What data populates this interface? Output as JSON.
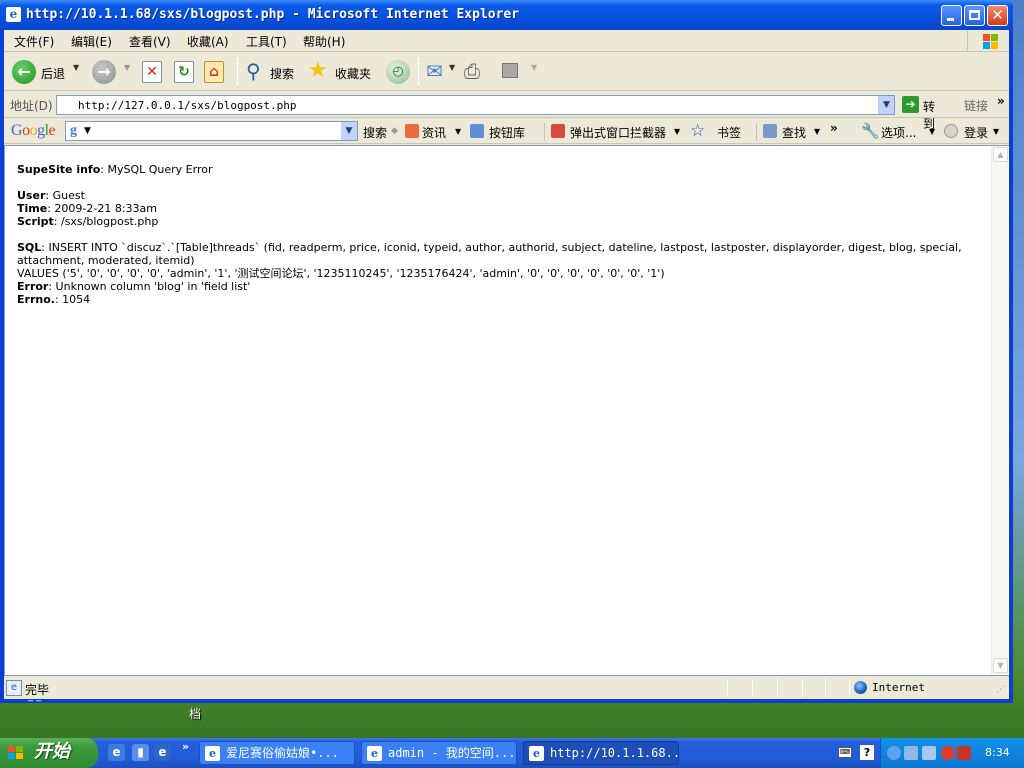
{
  "window": {
    "title": "http://10.1.1.68/sxs/blogpost.php - Microsoft Internet Explorer"
  },
  "menu": [
    "文件(F)",
    "编辑(E)",
    "查看(V)",
    "收藏(A)",
    "工具(T)",
    "帮助(H)"
  ],
  "toolbar": {
    "back_label": "后退",
    "search_label": "搜索",
    "favorites_label": "收藏夹"
  },
  "address": {
    "label": "地址(D)",
    "url": "http://127.0.0.1/sxs/blogpost.php",
    "go_label": "转到",
    "links_label": "链接"
  },
  "google_toolbar": {
    "logo": "Google",
    "search_label": "搜索",
    "news_label": "资讯",
    "buttons_label": "按钮库",
    "popup_blocker_label": "弹出式窗口拦截器",
    "bookmarks_label": "书签",
    "find_label": "查找",
    "options_label": "选项...",
    "login_label": "登录"
  },
  "page": {
    "info_label": "SupeSite info",
    "info_value": ": MySQL Query Error",
    "user_label": "User",
    "user_value": ": Guest",
    "time_label": "Time",
    "time_value": ": 2009-2-21 8:33am",
    "script_label": "Script",
    "script_value": ": /sxs/blogpost.php",
    "sql_label": "SQL",
    "sql_value": ": INSERT INTO `discuz`.`[Table]threads` (fid, readperm, price, iconid, typeid, author, authorid, subject, dateline, lastpost, lastposter, displayorder, digest, blog, special, attachment, moderated, itemid)",
    "sql_values": "VALUES ('5', '0', '0', '0', '0', 'admin', '1', '测试空间论坛', '1235110245', '1235176424', 'admin', '0', '0', '0', '0', '0', '0', '1')",
    "error_label": "Error",
    "error_value": ": Unknown column 'blog' in 'field list'",
    "errno_label": "Errno.",
    "errno_value": ": 1054"
  },
  "status": {
    "text": "完毕",
    "zone": "Internet"
  },
  "desktop": {
    "label": "档"
  },
  "taskbar": {
    "start_label": "开始",
    "tasks": [
      "爱尼赛俗偷姑娘•...",
      "admin - 我的空间...",
      "http://10.1.1.68..."
    ],
    "clock": "8:34"
  },
  "colors": {
    "titlebar": "#0a5ae8",
    "taskbar": "#245ddb",
    "start_button": "#3c9b3c",
    "chrome": "#ece9d8"
  }
}
